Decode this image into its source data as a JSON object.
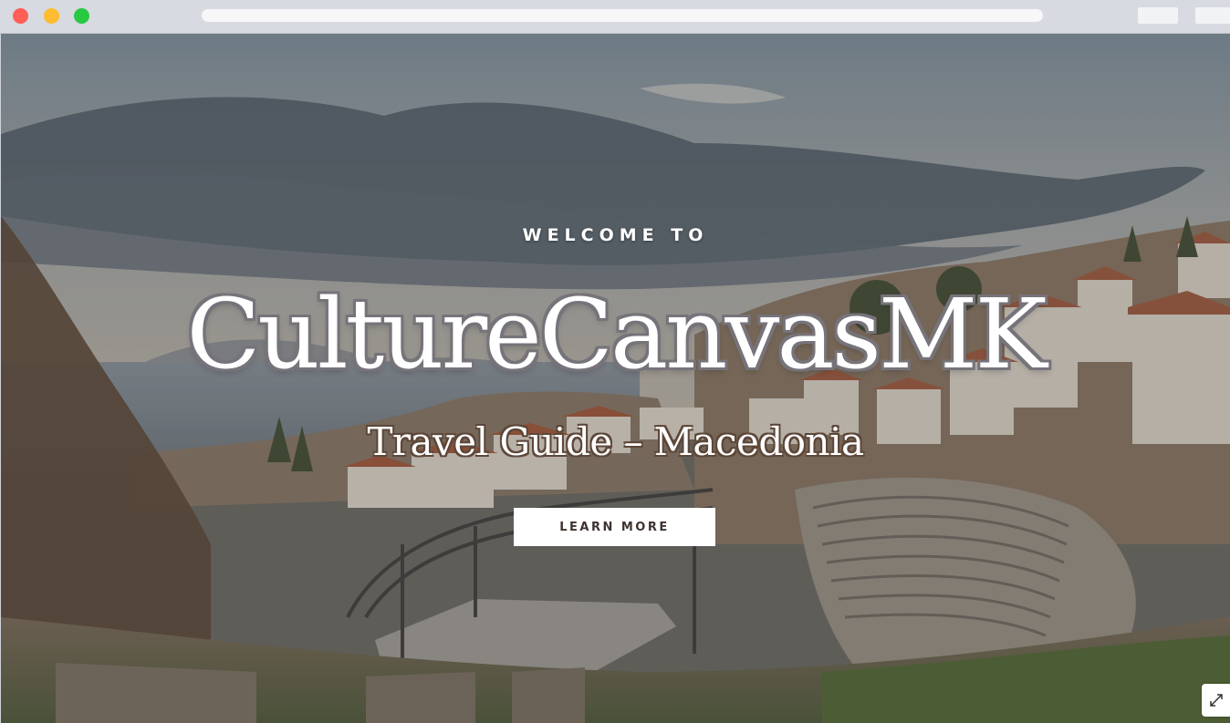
{
  "browser": {
    "traffic_lights": {
      "red": "#ff5f57",
      "yellow": "#febc2e",
      "green": "#28c840"
    }
  },
  "hero": {
    "eyebrow": "WELCOME TO",
    "title": "CultureCanvasMK",
    "subtitle": "Travel Guide – Macedonia",
    "cta_label": "LEARN MORE",
    "background_description_icon": "ancient-theatre-photo",
    "expand_icon": "expand-icon"
  },
  "colors": {
    "title_outline": "#77737a",
    "subtitle_outline": "#5d4739",
    "cta_text": "#3d3430"
  }
}
